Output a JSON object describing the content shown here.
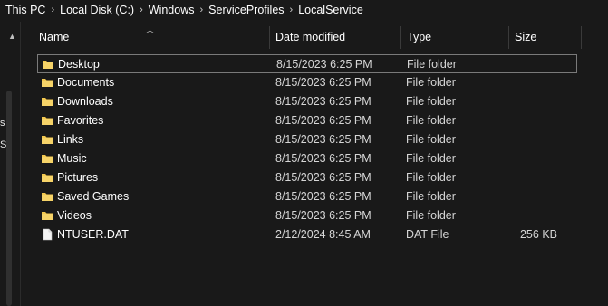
{
  "breadcrumb": [
    "This PC",
    "Local Disk (C:)",
    "Windows",
    "ServiceProfiles",
    "LocalService"
  ],
  "nav_pane": {
    "partial_chars": [
      "s",
      "S"
    ]
  },
  "columns": {
    "name": "Name",
    "date": "Date modified",
    "type": "Type",
    "size": "Size"
  },
  "files": [
    {
      "name": "Desktop",
      "date": "8/15/2023 6:25 PM",
      "type": "File folder",
      "size": "",
      "icon": "folder-icon",
      "selected": true
    },
    {
      "name": "Documents",
      "date": "8/15/2023 6:25 PM",
      "type": "File folder",
      "size": "",
      "icon": "folder-icon"
    },
    {
      "name": "Downloads",
      "date": "8/15/2023 6:25 PM",
      "type": "File folder",
      "size": "",
      "icon": "folder-icon"
    },
    {
      "name": "Favorites",
      "date": "8/15/2023 6:25 PM",
      "type": "File folder",
      "size": "",
      "icon": "folder-icon"
    },
    {
      "name": "Links",
      "date": "8/15/2023 6:25 PM",
      "type": "File folder",
      "size": "",
      "icon": "folder-icon"
    },
    {
      "name": "Music",
      "date": "8/15/2023 6:25 PM",
      "type": "File folder",
      "size": "",
      "icon": "folder-icon"
    },
    {
      "name": "Pictures",
      "date": "8/15/2023 6:25 PM",
      "type": "File folder",
      "size": "",
      "icon": "folder-icon"
    },
    {
      "name": "Saved Games",
      "date": "8/15/2023 6:25 PM",
      "type": "File folder",
      "size": "",
      "icon": "folder-icon"
    },
    {
      "name": "Videos",
      "date": "8/15/2023 6:25 PM",
      "type": "File folder",
      "size": "",
      "icon": "folder-icon"
    },
    {
      "name": "NTUSER.DAT",
      "date": "2/12/2024 8:45 AM",
      "type": "DAT File",
      "size": "256 KB",
      "icon": "file-icon"
    }
  ],
  "colors": {
    "background": "#191919",
    "folder": "#f2c74f",
    "text": "#ffffff",
    "muted_text": "#d6d6d6"
  }
}
